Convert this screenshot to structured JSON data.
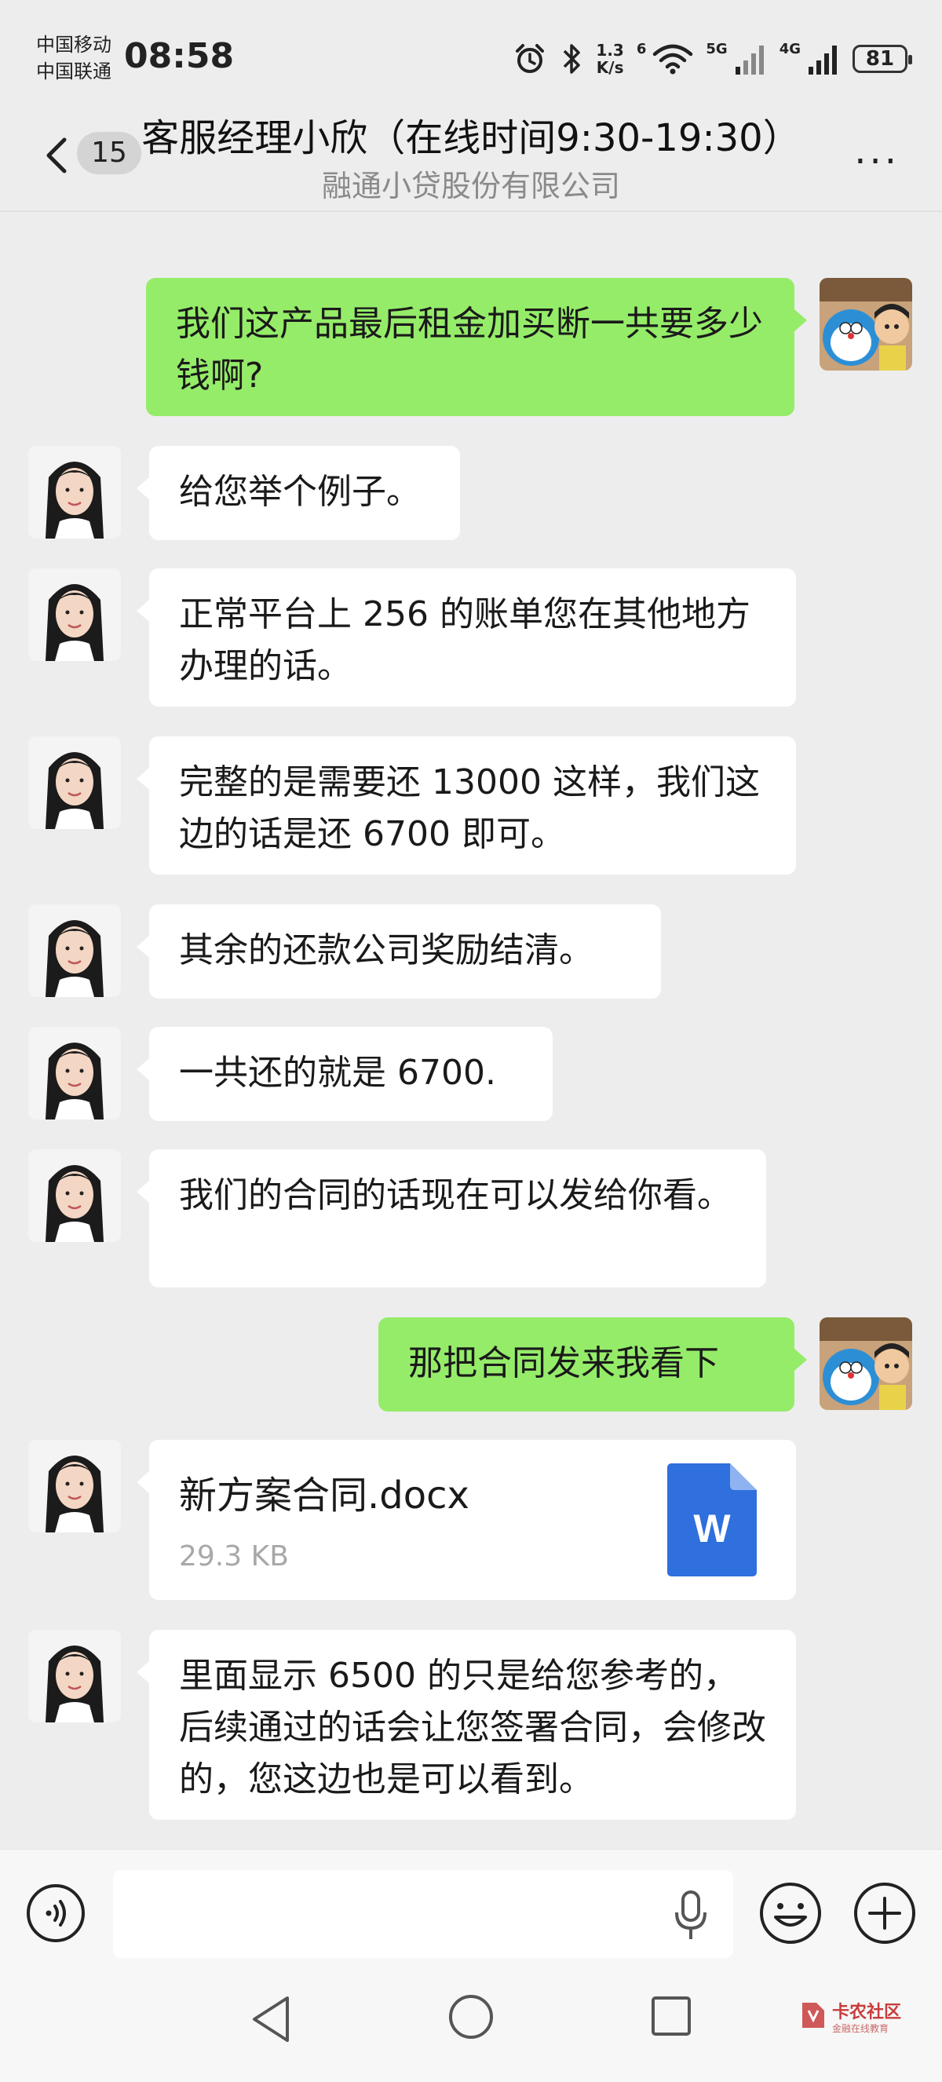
{
  "status": {
    "carrier_1": "中国移动",
    "carrier_2": "中国联通",
    "time": "08:58",
    "net_speed_value": "1.3",
    "net_speed_unit": "K/s",
    "wifi_label": "6",
    "signal_1_label": "5G",
    "signal_2_label": "4G",
    "battery": "81"
  },
  "header": {
    "unread_count": "15",
    "title": "客服经理小欣（在线时间9:30-19:30）",
    "subtitle": "融通小贷股份有限公司",
    "more_label": "···"
  },
  "messages": [
    {
      "side": "right",
      "text": "我们这产品最后租金加买断一共要多少钱啊?"
    },
    {
      "side": "left",
      "text": "给您举个例子。"
    },
    {
      "side": "left",
      "text": "正常平台上 256 的账单您在其他地方办理的话。"
    },
    {
      "side": "left",
      "text": "完整的是需要还 13000 这样，我们这边的话是还 6700 即可。"
    },
    {
      "side": "left",
      "text": "其余的还款公司奖励结清。"
    },
    {
      "side": "left",
      "text": "一共还的就是 6700."
    },
    {
      "side": "left",
      "text": "我们的合同的话现在可以发给你看。"
    },
    {
      "side": "right",
      "text": "那把合同发来我看下"
    },
    {
      "side": "left",
      "file_name": "新方案合同.docx",
      "file_size": "29.3 KB",
      "file_icon_letter": "W"
    },
    {
      "side": "left",
      "text": "里面显示 6500 的只是给您参考的，后续通过的话会让您签署合同，会修改的，您这边也是可以看到。"
    }
  ],
  "input": {
    "placeholder": ""
  },
  "watermark": {
    "title": "卡农社区",
    "subtitle": "金融在线教育"
  },
  "colors": {
    "background": "#ededed",
    "bubble_self": "#95ec69",
    "bubble_other": "#ffffff",
    "doc_icon": "#2f6fde",
    "watermark": "#c83c3c"
  },
  "icons": [
    "back-chevron-icon",
    "more-icon",
    "alarm-icon",
    "bluetooth-icon",
    "wifi-icon",
    "signal-icon",
    "battery-icon",
    "voice-icon",
    "microphone-icon",
    "emoji-icon",
    "plus-icon",
    "word-doc-icon",
    "nav-back-icon",
    "nav-home-icon",
    "nav-recent-icon"
  ]
}
